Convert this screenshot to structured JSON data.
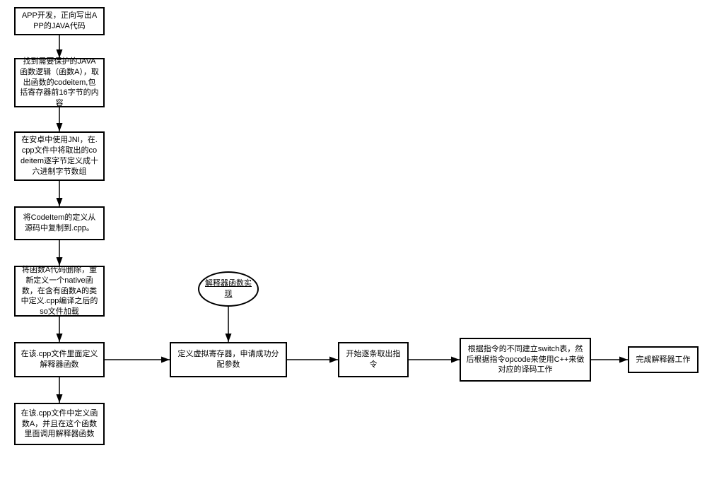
{
  "boxes": {
    "b1": "APP开发，正向写出APP的JAVA代码",
    "b2": "找到需要保护的JAVA函数逻辑（函数A），取出函数的codeitem,包括寄存器前16字节的内容",
    "b3": "在安卓中使用JNI，在.cpp文件中将取出的codeitem逐字节定义成十六进制字节数组",
    "b4": "将CodeItem的定义从源码中复制到.cpp。",
    "b5": "将函数A代码删除，重新定义一个native函数，在含有函数A的类中定义.cpp编译之后的so文件加载",
    "b6": "在该.cpp文件里面定义解释器函数",
    "b7": "在该.cpp文件中定义函数A，并且在这个函数里面调用解释器函数",
    "e1": "解释器函数实现",
    "b8": "定义虚拟寄存器，申请成功分配参数",
    "b9": "开始逐条取出指令",
    "b10": "根据指令的不同建立switch表，然后根据指令opcode来使用C++来做对应的译码工作",
    "b11": "完成解释器工作"
  }
}
